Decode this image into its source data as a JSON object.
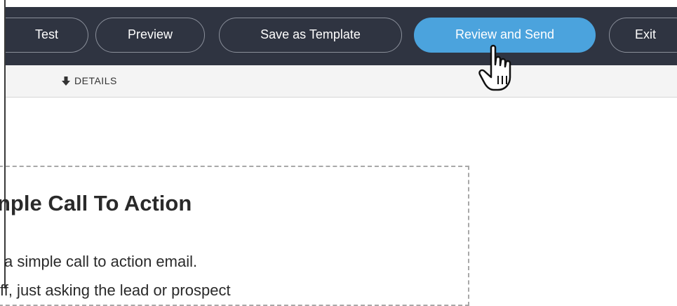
{
  "toolbar": {
    "test_label": "Test",
    "preview_label": "Preview",
    "save_template_label": "Save as Template",
    "review_send_label": "Review and Send",
    "exit_label": "Exit"
  },
  "subbar": {
    "details_label": "DETAILS"
  },
  "content": {
    "heading": "nple Call To Action",
    "line1": "a simple call to action email.",
    "line2": "ff, just asking the lead or prospect"
  },
  "colors": {
    "topbar_bg": "#2f3441",
    "accent": "#4ba3dd",
    "subbar_bg": "#f4f4f4"
  },
  "icons": {
    "details_icon": "arrow-down-icon",
    "cursor": "hand-pointer-cursor"
  }
}
